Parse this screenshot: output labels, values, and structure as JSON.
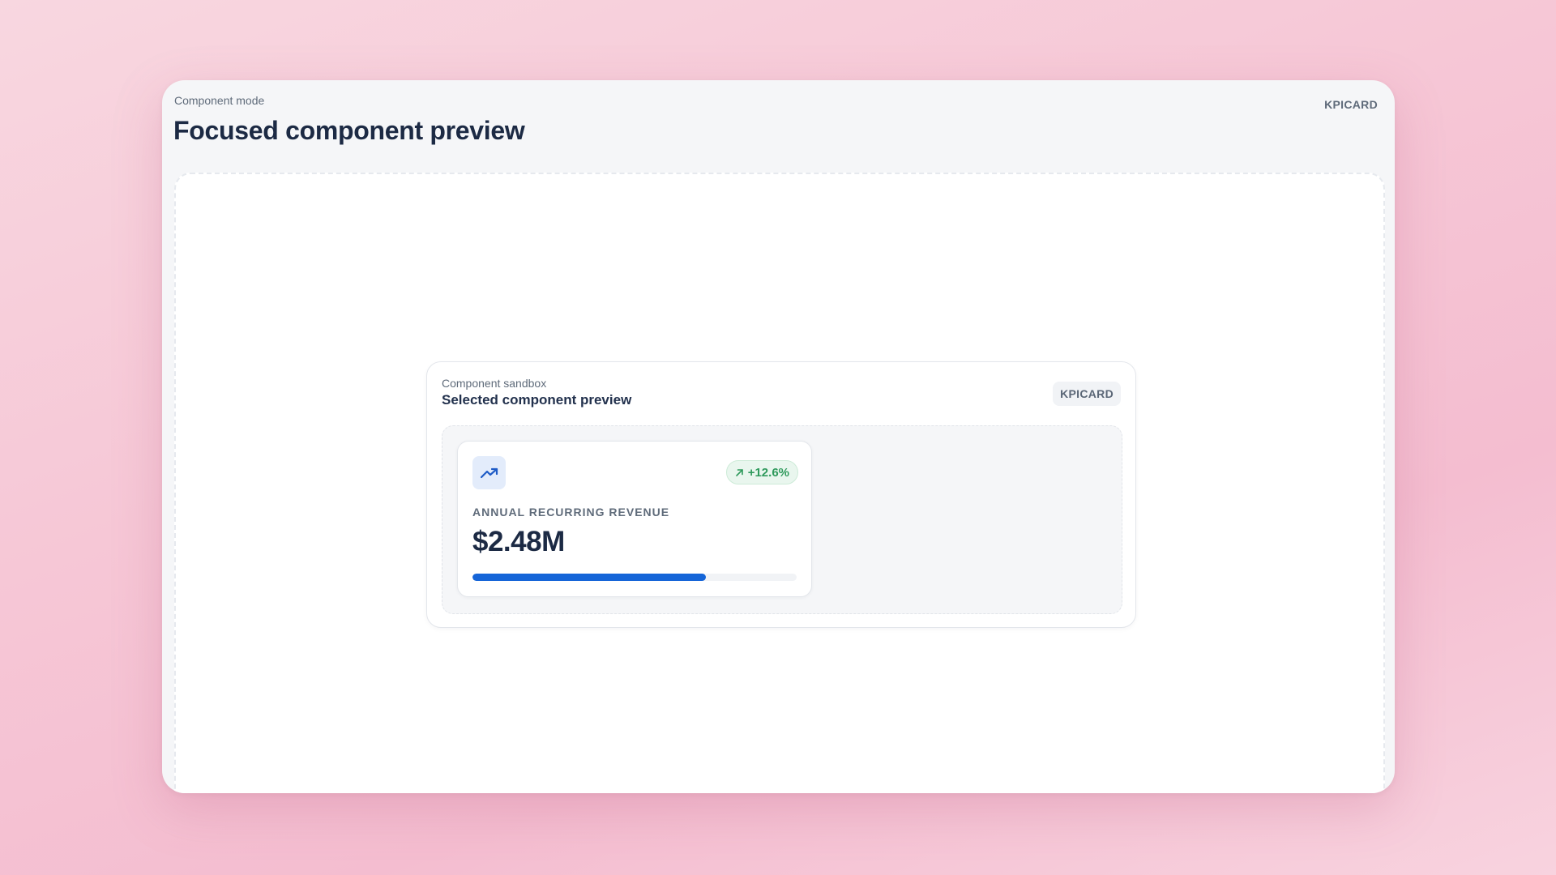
{
  "header": {
    "mode_label": "Component mode",
    "title": "Focused component preview",
    "badge": "KPICARD"
  },
  "sandbox": {
    "kicker": "Component sandbox",
    "title": "Selected component preview",
    "badge": "KPICARD"
  },
  "kpi_card": {
    "icon": "trending-up-icon",
    "trend": {
      "icon": "arrow-up-right-icon",
      "value": "+12.6%"
    },
    "label": "ANNUAL RECURRING REVENUE",
    "value": "$2.48M",
    "progress": 0.72
  },
  "colors": {
    "accent": "#1565d8",
    "positive": "#2f9a5c",
    "title": "#1c2a44"
  }
}
